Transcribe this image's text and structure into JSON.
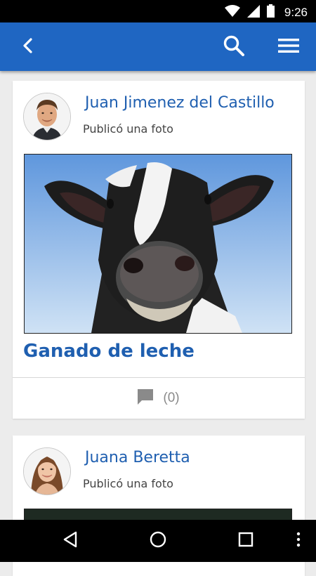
{
  "status_bar": {
    "time": "9:26",
    "icons": [
      "wifi-icon",
      "signal-icon",
      "battery-icon"
    ]
  },
  "app_bar": {
    "color": "#1f66c2",
    "icons": [
      "back-arrow-icon",
      "search-icon",
      "hamburger-menu-icon"
    ]
  },
  "feed": {
    "posts": [
      {
        "author": "Juan Jimenez del Castillo",
        "action": "Publicó una foto",
        "title": "Ganado de leche",
        "comment_count": "(0)"
      },
      {
        "author": "Juana Beretta",
        "action": "Publicó una foto"
      }
    ]
  },
  "nav_bar": {
    "icons": [
      "back-triangle-icon",
      "home-circle-icon",
      "recents-square-icon",
      "more-vert-icon"
    ]
  },
  "colors": {
    "accent": "#1f66c2",
    "link_text": "#1f5fb0",
    "background": "#ececec"
  }
}
